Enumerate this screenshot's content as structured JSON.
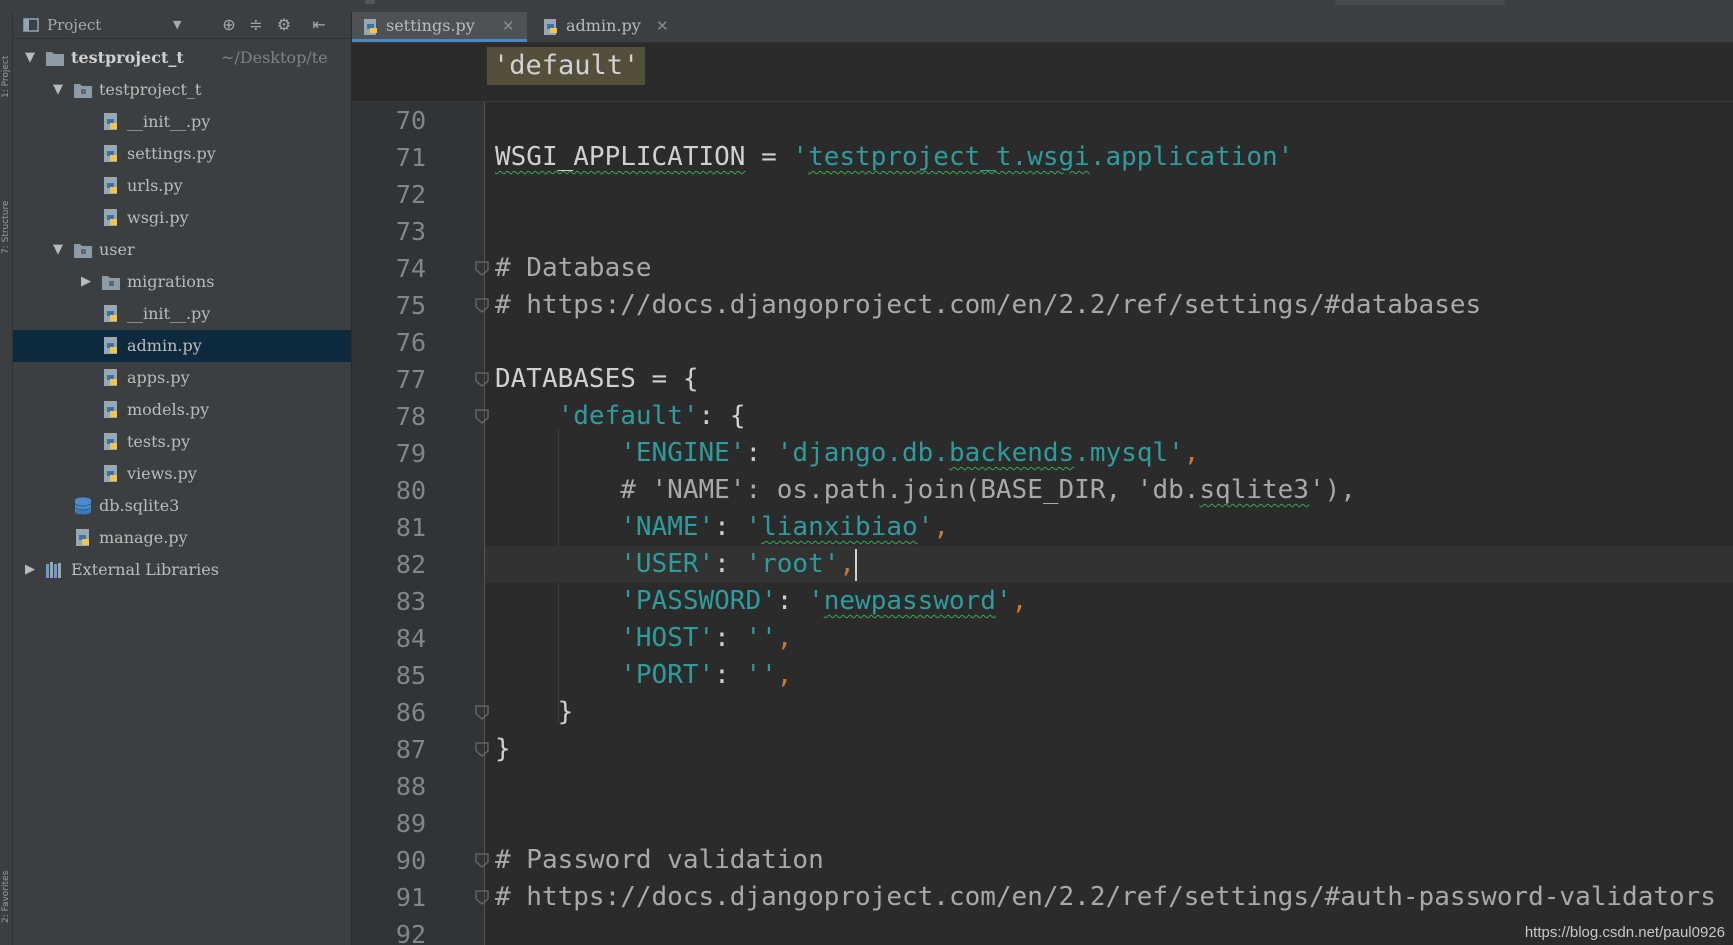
{
  "project_panel": {
    "view_label": "Project",
    "dropdown_icon": "triangle-down-icon",
    "header_icons": [
      "locate-icon",
      "collapse-all-icon",
      "gear-icon",
      "hide-panel-icon"
    ],
    "tree": [
      {
        "label": "testproject_t",
        "path": "~/Desktop/te",
        "type": "folder",
        "expanded": true
      },
      {
        "label": "testproject_t",
        "type": "package",
        "expanded": true
      },
      {
        "label": "__init__.py",
        "type": "python-file"
      },
      {
        "label": "settings.py",
        "type": "python-file"
      },
      {
        "label": "urls.py",
        "type": "python-file"
      },
      {
        "label": "wsgi.py",
        "type": "python-file"
      },
      {
        "label": "user",
        "type": "package",
        "expanded": true
      },
      {
        "label": "migrations",
        "type": "package",
        "expanded": false
      },
      {
        "label": "__init__.py",
        "type": "python-file"
      },
      {
        "label": "admin.py",
        "type": "python-file",
        "selected": true
      },
      {
        "label": "apps.py",
        "type": "python-file"
      },
      {
        "label": "models.py",
        "type": "python-file"
      },
      {
        "label": "tests.py",
        "type": "python-file"
      },
      {
        "label": "views.py",
        "type": "python-file"
      },
      {
        "label": "db.sqlite3",
        "type": "database-file"
      },
      {
        "label": "manage.py",
        "type": "python-file"
      },
      {
        "label": "External Libraries",
        "type": "libraries",
        "expanded": false
      }
    ]
  },
  "tool_strip": {
    "project_label": "1: Project",
    "structure_label": "7: Structure",
    "favorites_label": "2: Favorites"
  },
  "tabs": [
    {
      "label": "settings.py",
      "active": true,
      "close_icon": "close-icon"
    },
    {
      "label": "admin.py",
      "active": false,
      "close_icon": "close-icon"
    }
  ],
  "breadcrumb": "'default'",
  "editor": {
    "current_line": 82,
    "lines": [
      {
        "n": "70",
        "tokens": []
      },
      {
        "n": "71",
        "tokens": [
          {
            "t": "WSGI_APPLICATION",
            "c": "plain",
            "u": true
          },
          {
            "t": " = ",
            "c": "plain"
          },
          {
            "t": "'",
            "c": "str"
          },
          {
            "t": "testproject_t.wsgi",
            "c": "str",
            "u": true
          },
          {
            "t": ".application'",
            "c": "str"
          }
        ]
      },
      {
        "n": "72",
        "tokens": []
      },
      {
        "n": "73",
        "tokens": []
      },
      {
        "n": "74",
        "fold": true,
        "tokens": [
          {
            "t": "# Database",
            "c": "comment"
          }
        ]
      },
      {
        "n": "75",
        "fold": true,
        "tokens": [
          {
            "t": "# https://docs.djangoproject.com/en/2.2/ref/settings/#databases",
            "c": "comment"
          }
        ]
      },
      {
        "n": "76",
        "tokens": []
      },
      {
        "n": "77",
        "fold": true,
        "tokens": [
          {
            "t": "DATABASES = {",
            "c": "plain"
          }
        ]
      },
      {
        "n": "78",
        "fold": true,
        "tokens": [
          {
            "t": "    ",
            "c": "plain"
          },
          {
            "t": "'default'",
            "c": "str"
          },
          {
            "t": ": {",
            "c": "plain"
          }
        ]
      },
      {
        "n": "79",
        "tokens": [
          {
            "t": "        ",
            "c": "plain"
          },
          {
            "t": "'ENGINE'",
            "c": "str"
          },
          {
            "t": ": ",
            "c": "plain"
          },
          {
            "t": "'django.db.",
            "c": "str"
          },
          {
            "t": "backends",
            "c": "str",
            "u": true
          },
          {
            "t": ".mysql'",
            "c": "str"
          },
          {
            "t": ",",
            "c": "punct"
          }
        ]
      },
      {
        "n": "80",
        "tokens": [
          {
            "t": "        # 'NAME': os.path.join(BASE_DIR, 'db.",
            "c": "comment"
          },
          {
            "t": "sqlite3",
            "c": "comment",
            "u": true
          },
          {
            "t": "'),",
            "c": "comment"
          }
        ]
      },
      {
        "n": "81",
        "tokens": [
          {
            "t": "        ",
            "c": "plain"
          },
          {
            "t": "'NAME'",
            "c": "str"
          },
          {
            "t": ": ",
            "c": "plain"
          },
          {
            "t": "'",
            "c": "str"
          },
          {
            "t": "lianxibiao",
            "c": "str",
            "u": true
          },
          {
            "t": "'",
            "c": "str"
          },
          {
            "t": ",",
            "c": "punct"
          }
        ]
      },
      {
        "n": "82",
        "tokens": [
          {
            "t": "        ",
            "c": "plain"
          },
          {
            "t": "'USER'",
            "c": "str"
          },
          {
            "t": ": ",
            "c": "plain"
          },
          {
            "t": "'root'",
            "c": "str"
          },
          {
            "t": ",",
            "c": "punct"
          }
        ]
      },
      {
        "n": "83",
        "tokens": [
          {
            "t": "        ",
            "c": "plain"
          },
          {
            "t": "'PASSWORD'",
            "c": "str"
          },
          {
            "t": ": ",
            "c": "plain"
          },
          {
            "t": "'",
            "c": "str"
          },
          {
            "t": "newpassword",
            "c": "str",
            "u": true
          },
          {
            "t": "'",
            "c": "str"
          },
          {
            "t": ",",
            "c": "punct"
          }
        ]
      },
      {
        "n": "84",
        "tokens": [
          {
            "t": "        ",
            "c": "plain"
          },
          {
            "t": "'HOST'",
            "c": "str"
          },
          {
            "t": ": ",
            "c": "plain"
          },
          {
            "t": "''",
            "c": "str"
          },
          {
            "t": ",",
            "c": "punct"
          }
        ]
      },
      {
        "n": "85",
        "tokens": [
          {
            "t": "        ",
            "c": "plain"
          },
          {
            "t": "'PORT'",
            "c": "str"
          },
          {
            "t": ": ",
            "c": "plain"
          },
          {
            "t": "''",
            "c": "str"
          },
          {
            "t": ",",
            "c": "punct"
          }
        ]
      },
      {
        "n": "86",
        "fold": true,
        "tokens": [
          {
            "t": "    }",
            "c": "plain"
          }
        ]
      },
      {
        "n": "87",
        "fold": true,
        "tokens": [
          {
            "t": "}",
            "c": "plain"
          }
        ]
      },
      {
        "n": "88",
        "tokens": []
      },
      {
        "n": "89",
        "tokens": []
      },
      {
        "n": "90",
        "fold": true,
        "tokens": [
          {
            "t": "# Password validation",
            "c": "comment"
          }
        ]
      },
      {
        "n": "91",
        "fold": true,
        "tokens": [
          {
            "t": "# https://docs.djangoproject.com/en/2.2/ref/settings/#auth-password-validators",
            "c": "comment"
          }
        ]
      },
      {
        "n": "92",
        "tokens": []
      }
    ]
  },
  "colors": {
    "background": "#2b2b2b",
    "panel": "#3c3f41",
    "selection": "#0d293e",
    "string": "#2f9c9c",
    "comment": "#a9a9a9",
    "punctuation": "#cc7832",
    "breadcrumb_chip": "#52503a",
    "tab_underline": "#4a88c7"
  },
  "watermark": "https://blog.csdn.net/paul0926"
}
